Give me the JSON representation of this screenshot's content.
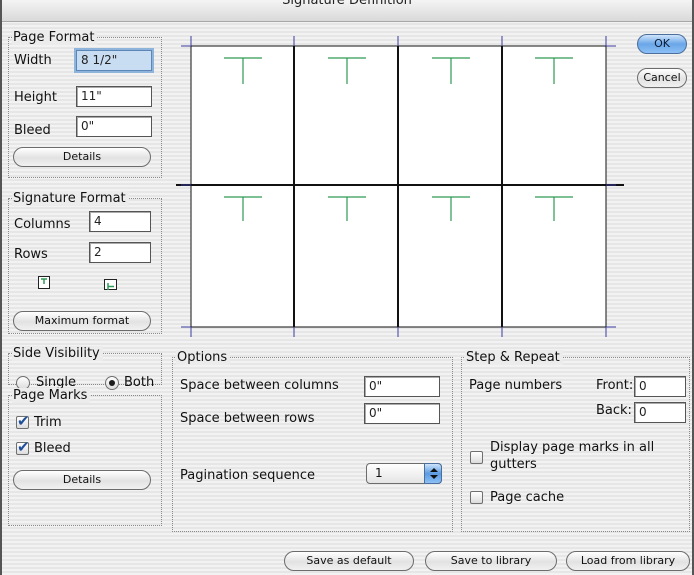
{
  "window": {
    "title": "Signature Definition"
  },
  "page_format": {
    "title": "Page Format",
    "width_label": "Width",
    "width_value": "8 1/2\"",
    "height_label": "Height",
    "height_value": "11\"",
    "bleed_label": "Bleed",
    "bleed_value": "0\"",
    "details_label": "Details"
  },
  "signature_format": {
    "title": "Signature Format",
    "columns_label": "Columns",
    "columns_value": "4",
    "rows_label": "Rows",
    "rows_value": "2",
    "icon_top": "trim-mark-top-icon",
    "icon_side": "trim-mark-side-icon",
    "max_format_label": "Maximum format"
  },
  "side_visibility": {
    "title": "Side Visibility",
    "single_label": "Single",
    "both_label": "Both",
    "selected": "Both"
  },
  "page_marks": {
    "title": "Page Marks",
    "trim_label": "Trim",
    "trim_checked": true,
    "bleed_label": "Bleed",
    "bleed_checked": true,
    "details_label": "Details"
  },
  "options": {
    "title": "Options",
    "space_columns_label": "Space between columns",
    "space_columns_value": "0\"",
    "space_rows_label": "Space between rows",
    "space_rows_value": "0\"",
    "pagination_label": "Pagination sequence",
    "pagination_value": "1"
  },
  "step_repeat": {
    "title": "Step & Repeat",
    "page_numbers_label": "Page numbers",
    "front_label": "Front:",
    "front_value": "0",
    "back_label": "Back:",
    "back_value": "0",
    "display_marks_label_1": "Display page marks in all",
    "display_marks_label_2": "gutters",
    "display_marks_checked": false,
    "page_cache_label": "Page cache",
    "page_cache_checked": false
  },
  "dialog_buttons": {
    "ok": "OK",
    "cancel": "Cancel",
    "save_default": "Save as default",
    "save_library": "Save to library",
    "load_library": "Load from library"
  },
  "preview": {
    "columns": 4,
    "rows": 2,
    "page_mark_color": "#2f9a55",
    "crop_mark_color": "#3a3aa0"
  }
}
